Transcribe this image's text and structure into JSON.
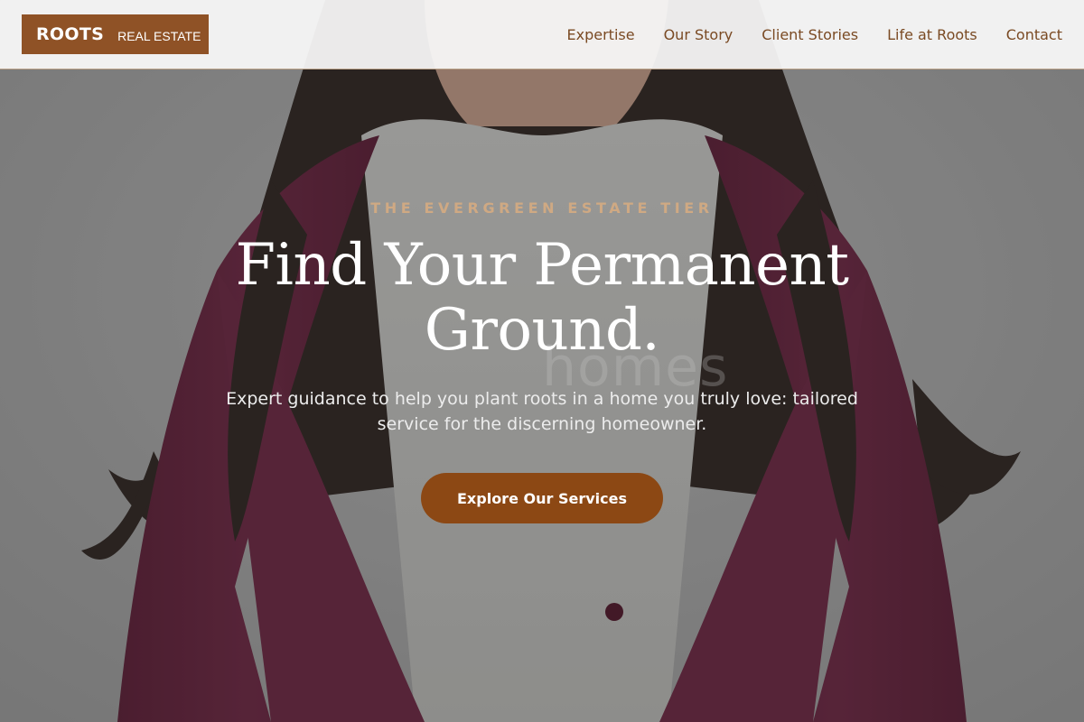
{
  "brand": {
    "name": "ROOTS",
    "tagline": "REAL ESTATE",
    "color": "#8f5226"
  },
  "nav": {
    "items": [
      {
        "label": "Expertise"
      },
      {
        "label": "Our Story"
      },
      {
        "label": "Client Stories"
      },
      {
        "label": "Life at Roots"
      },
      {
        "label": "Contact"
      }
    ],
    "link_color": "#7a4a23"
  },
  "hero": {
    "eyebrow": "THE EVERGREEN ESTATE TIER",
    "headline": "Find Your Permanent Ground.",
    "subtext": "Expert guidance to help you plant roots in a home you truly love: tailored service for the discerning homeowner.",
    "cta_label": "Explore Our Services",
    "background_watermark": "homes",
    "accent_color": "#cfa983",
    "button_color": "#8c4814"
  }
}
